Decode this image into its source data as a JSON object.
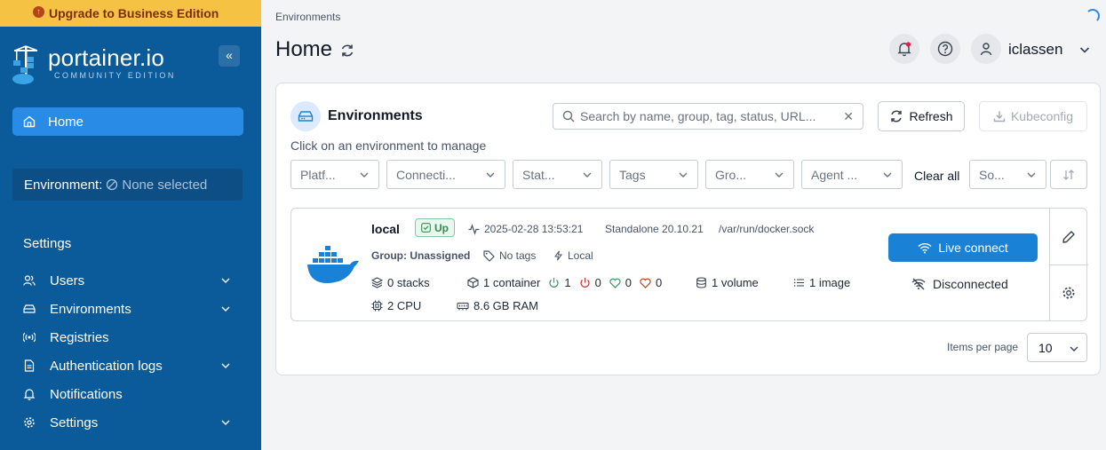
{
  "upgrade_banner": "Upgrade to Business Edition",
  "logo": {
    "title": "portainer.io",
    "subtitle": "COMMUNITY EDITION"
  },
  "sidebar": {
    "home_label": "Home",
    "environment_label": "Environment:",
    "environment_value": "None selected",
    "settings_heading": "Settings",
    "items": [
      {
        "label": "Users",
        "icon": "users-icon",
        "expandable": true
      },
      {
        "label": "Environments",
        "icon": "environments-icon",
        "expandable": true
      },
      {
        "label": "Registries",
        "icon": "registries-icon",
        "expandable": false
      },
      {
        "label": "Authentication logs",
        "icon": "file-icon",
        "expandable": true
      },
      {
        "label": "Notifications",
        "icon": "bell-icon",
        "expandable": false
      },
      {
        "label": "Settings",
        "icon": "gear-icon",
        "expandable": true
      }
    ]
  },
  "header": {
    "breadcrumb": "Environments",
    "title": "Home",
    "user_name": "iclassen"
  },
  "panel": {
    "title": "Environments",
    "search_placeholder": "Search by name, group, tag, status, URL...",
    "refresh_label": "Refresh",
    "kubeconfig_label": "Kubeconfig",
    "hint": "Click on an environment to manage",
    "filters": [
      "Platf...",
      "Connecti...",
      "Stat...",
      "Tags",
      "Gro...",
      "Agent ..."
    ],
    "clear_all": "Clear all",
    "sort_label": "So..."
  },
  "environment": {
    "name": "local",
    "status": "Up",
    "timestamp": "2025-02-28 13:53:21",
    "platform": "Standalone 20.10.21",
    "url": "/var/run/docker.sock",
    "group": "Group: Unassigned",
    "tags": "No tags",
    "type": "Local",
    "stacks": "0 stacks",
    "containers": "1 container",
    "running": "1",
    "stopped": "0",
    "healthy": "0",
    "unhealthy": "0",
    "volumes": "1 volume",
    "images": "1 image",
    "cpu": "2 CPU",
    "ram": "8.6 GB RAM",
    "live_connect": "Live connect",
    "connection_state": "Disconnected"
  },
  "pagination": {
    "items_per_page_label": "Items per page",
    "items_per_page_value": "10"
  },
  "colors": {
    "sidebar": "#0b5a99",
    "accent": "#2a8be6",
    "banner": "#f5c243",
    "live_connect": "#1a82d6",
    "up": "#2f8f4e"
  }
}
